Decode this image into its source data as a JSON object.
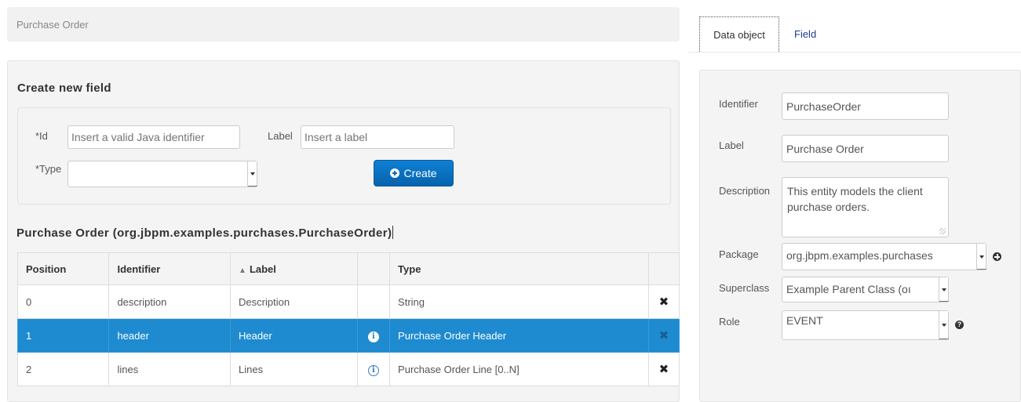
{
  "header": {
    "title": "Purchase Order"
  },
  "create_section": {
    "heading": "Create new field",
    "id_label": "*Id",
    "id_placeholder": "Insert a valid Java identifier",
    "label_label": "Label",
    "label_placeholder": "Insert a label",
    "type_label": "*Type",
    "type_value": "",
    "create_button_label": "Create"
  },
  "entity": {
    "heading": "Purchase Order (org.jbpm.examples.purchases.PurchaseOrder)"
  },
  "table": {
    "columns": [
      "Position",
      "Identifier",
      "Label",
      "",
      "Type",
      ""
    ],
    "sort_column": "Label",
    "rows": [
      {
        "position": "0",
        "identifier": "description",
        "label": "Description",
        "has_info": false,
        "type": "String",
        "selected": false
      },
      {
        "position": "1",
        "identifier": "header",
        "label": "Header",
        "has_info": true,
        "type": "Purchase Order Header",
        "selected": true
      },
      {
        "position": "2",
        "identifier": "lines",
        "label": "Lines",
        "has_info": true,
        "type": "Purchase Order Line [0..N]",
        "selected": false
      }
    ]
  },
  "right": {
    "tabs": [
      {
        "label": "Data object",
        "active": true
      },
      {
        "label": "Field",
        "active": false
      }
    ],
    "identifier_label": "Identifier",
    "identifier_value": "PurchaseOrder",
    "label_label": "Label",
    "label_value": "Purchase Order",
    "description_label": "Description",
    "description_value": "This entity models the client purchase orders.",
    "package_label": "Package",
    "package_value": "org.jbpm.examples.purchases",
    "superclass_label": "Superclass",
    "superclass_value": "Example Parent Class (oı",
    "role_label": "Role",
    "role_value": "EVENT"
  },
  "colors": {
    "primary_button": "#0a6bb8",
    "selected_row": "#1e8bd0",
    "panel_bg": "#f4f4f4"
  },
  "icons": {
    "create": "plus-circle-icon",
    "delete": "close-icon",
    "info": "info-icon",
    "sort": "sort-up-icon",
    "package_add": "plus-circle-icon",
    "role_help": "question-circle-icon"
  }
}
